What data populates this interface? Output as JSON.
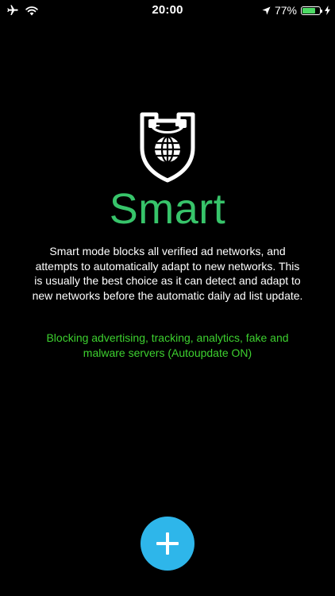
{
  "status_bar": {
    "time": "20:00",
    "battery_percent_label": "77%",
    "battery_level": 0.77,
    "icons": [
      "airplane-icon",
      "wifi-icon",
      "location-arrow-icon",
      "battery-icon",
      "charging-bolt-icon"
    ]
  },
  "main": {
    "logo_icon": "shield-globe-plug-icon",
    "mode_title": "Smart",
    "description": "Smart mode blocks all verified ad networks, and attempts to automatically adapt to new networks. This is usually the best choice as it can detect and adapt to new networks before the automatic daily ad list update.",
    "status_text": "Blocking advertising, tracking, analytics, fake and malware servers (Autoupdate ON)"
  },
  "fab": {
    "icon": "plus-icon"
  },
  "colors": {
    "background": "#000000",
    "title_green": "#37c46a",
    "status_green": "#3dd12f",
    "fab_blue": "#2eb6ea",
    "battery_green": "#4cd964"
  }
}
